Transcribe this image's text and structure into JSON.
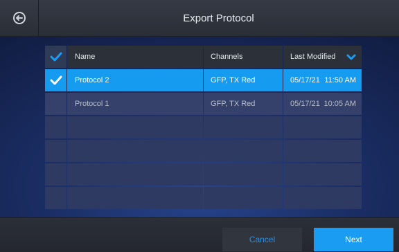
{
  "header": {
    "title": "Export Protocol",
    "back_icon": "back-arrow-icon"
  },
  "table": {
    "columns": {
      "name": "Name",
      "channels": "Channels",
      "last_modified": "Last Modified"
    },
    "rows": [
      {
        "selected": true,
        "name": "Protocol 2",
        "channels": "GFP, TX Red",
        "date": "05/17/21",
        "time": "11:50 AM"
      },
      {
        "selected": false,
        "name": "Protocol 1",
        "channels": "GFP, TX Red",
        "date": "05/17/21",
        "time": "10:05 AM"
      }
    ]
  },
  "footer": {
    "cancel_label": "Cancel",
    "next_label": "Next"
  },
  "colors": {
    "accent": "#199cf2",
    "selected_row": "#159bf0",
    "background": "#1a2d63"
  }
}
